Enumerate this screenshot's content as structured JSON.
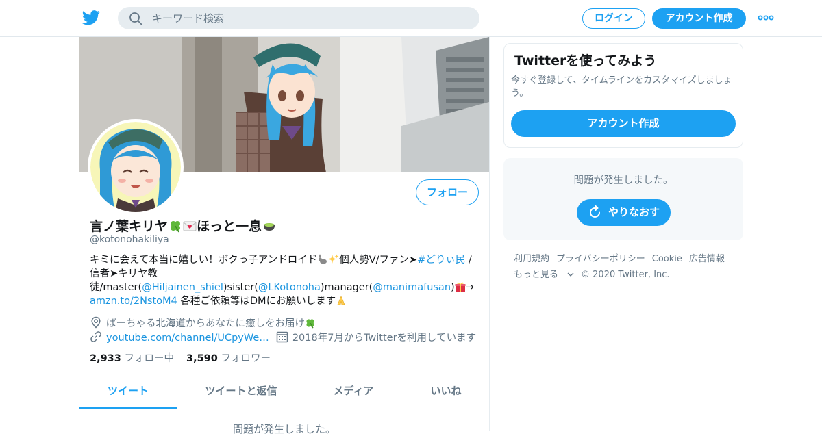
{
  "colors": {
    "accent": "#1da1f2",
    "link": "#1b95e0",
    "muted": "#657786",
    "text": "#14171a",
    "border": "#e6ecf0"
  },
  "header": {
    "logo_icon": "twitter-bird-icon",
    "search_placeholder": "キーワード検索",
    "login_label": "ログイン",
    "signup_label": "アカウント作成",
    "more_icon": "more-dots-icon"
  },
  "profile": {
    "follow_label": "フォロー",
    "display_name": "言ノ葉キリヤ",
    "display_name_suffix": "ほっと一息",
    "name_emoji": [
      "four-leaf-clover-icon",
      "love-letter-icon",
      "tea-cup-icon"
    ],
    "handle": "@kotonohakiliya",
    "bio": {
      "t1": "キミに会えて本当に嬉しい！ボクっ子アンドロイド",
      "t2": "個人勢V/ファン➤",
      "hashtag": "#どりぃ民",
      "t3": " /信者➤キリヤ教徒/master(",
      "mention1": "@Hiljainen_shiel",
      "t4": ")sister(",
      "mention2": "@LKotonoha",
      "t5": ")manager(",
      "mention3": "@manimafusan",
      "t6": ")",
      "t7": "→ ",
      "link": "amzn.to/2NstoM4",
      "t8": " 各種ご依頼等はDMにお願いします"
    },
    "location": "ばーちゃる北海道からあなたに癒しをお届け",
    "url": "youtube.com/channel/UCpyWe…",
    "joined": "2018年7月からTwitterを利用しています",
    "following_count": "2,933",
    "following_label": "フォロー中",
    "followers_count": "3,590",
    "followers_label": "フォロワー",
    "tabs": [
      "ツイート",
      "ツイートと返信",
      "メディア",
      "いいね"
    ],
    "active_tab": "ツイート",
    "timeline_error": "問題が発生しました。"
  },
  "sidebar": {
    "signup_card": {
      "title": "Twitterを使ってみよう",
      "desc": "今すぐ登録して、タイムラインをカスタマイズしましょう。",
      "button": "アカウント作成"
    },
    "error_card": {
      "message": "問題が発生しました。",
      "retry_label": "やりなおす"
    },
    "footer": {
      "terms": "利用規約",
      "privacy": "プライバシーポリシー",
      "cookie": "Cookie",
      "ads": "広告情報",
      "more": "もっと見る",
      "copyright": "© 2020 Twitter, Inc."
    }
  }
}
